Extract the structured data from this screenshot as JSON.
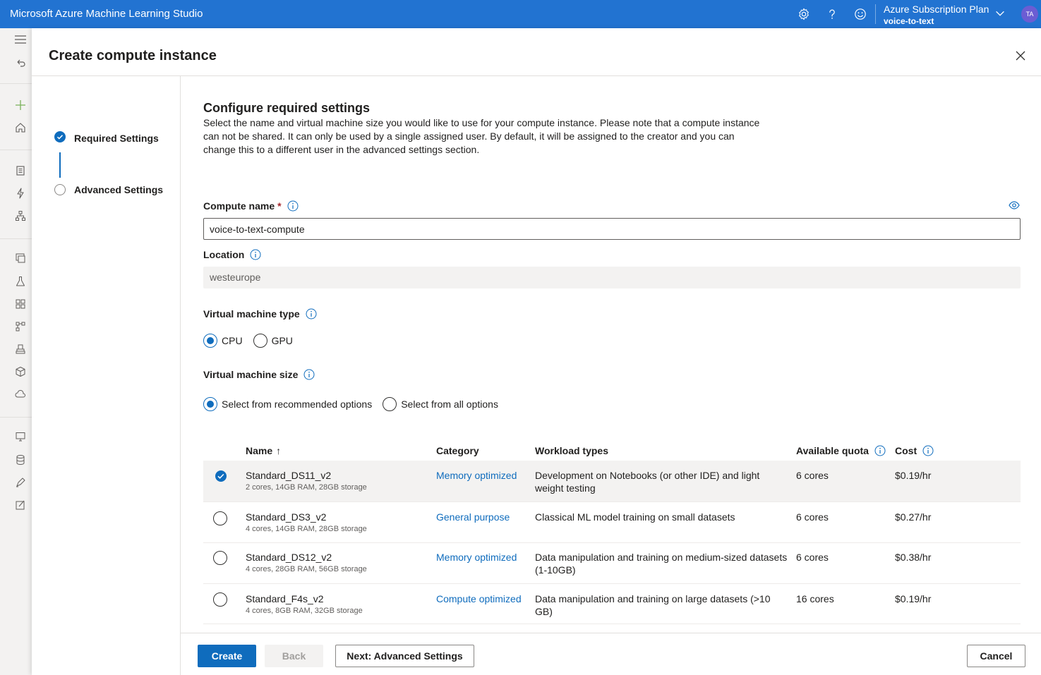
{
  "topbar": {
    "app_title": "Microsoft Azure Machine Learning Studio",
    "subscription_plan": "Azure Subscription Plan",
    "workspace": "voice-to-text",
    "avatar_initials": "TA"
  },
  "panel": {
    "title": "Create compute instance",
    "steps": [
      {
        "label": "Required Settings",
        "state": "complete"
      },
      {
        "label": "Advanced Settings",
        "state": "pending"
      }
    ]
  },
  "form": {
    "section_title": "Configure required settings",
    "description": "Select the name and virtual machine size you would like to use for your compute instance. Please note that a compute instance can not be shared. It can only be used by a single assigned user. By default, it will be assigned to the creator and you can change this to a different user in the advanced settings section.",
    "compute_name_label": "Compute name",
    "required_mark": "*",
    "compute_name_value": "voice-to-text-compute",
    "location_label": "Location",
    "location_value": "westeurope",
    "vm_type_label": "Virtual machine type",
    "vm_type_options": [
      "CPU",
      "GPU"
    ],
    "vm_type_selected": "CPU",
    "vm_size_label": "Virtual machine size",
    "vm_size_options": [
      "Select from recommended options",
      "Select from all options"
    ],
    "vm_size_selected": "Select from recommended options"
  },
  "table": {
    "headers": {
      "name": "Name",
      "sort_indicator": "↑",
      "category": "Category",
      "workload": "Workload types",
      "quota": "Available quota",
      "cost": "Cost"
    },
    "rows": [
      {
        "name": "Standard_DS11_v2",
        "specs": "2 cores, 14GB RAM, 28GB storage",
        "category": "Memory optimized",
        "workload": "Development on Notebooks (or other IDE) and light weight testing",
        "quota": "6 cores",
        "cost": "$0.19/hr",
        "selected": true
      },
      {
        "name": "Standard_DS3_v2",
        "specs": "4 cores, 14GB RAM, 28GB storage",
        "category": "General purpose",
        "workload": "Classical ML model training on small datasets",
        "quota": "6 cores",
        "cost": "$0.27/hr",
        "selected": false
      },
      {
        "name": "Standard_DS12_v2",
        "specs": "4 cores, 28GB RAM, 56GB storage",
        "category": "Memory optimized",
        "workload": "Data manipulation and training on medium-sized datasets (1-10GB)",
        "quota": "6 cores",
        "cost": "$0.38/hr",
        "selected": false
      },
      {
        "name": "Standard_F4s_v2",
        "specs": "4 cores, 8GB RAM, 32GB storage",
        "category": "Compute optimized",
        "workload": "Data manipulation and training on large datasets (>10 GB)",
        "quota": "16 cores",
        "cost": "$0.19/hr",
        "selected": false
      }
    ]
  },
  "footer": {
    "create_label": "Create",
    "back_label": "Back",
    "next_label": "Next: Advanced Settings",
    "cancel_label": "Cancel"
  },
  "colors": {
    "topbar": "#2273d1",
    "accent": "#0f6cbd",
    "avatar": "#6b5dd3"
  }
}
